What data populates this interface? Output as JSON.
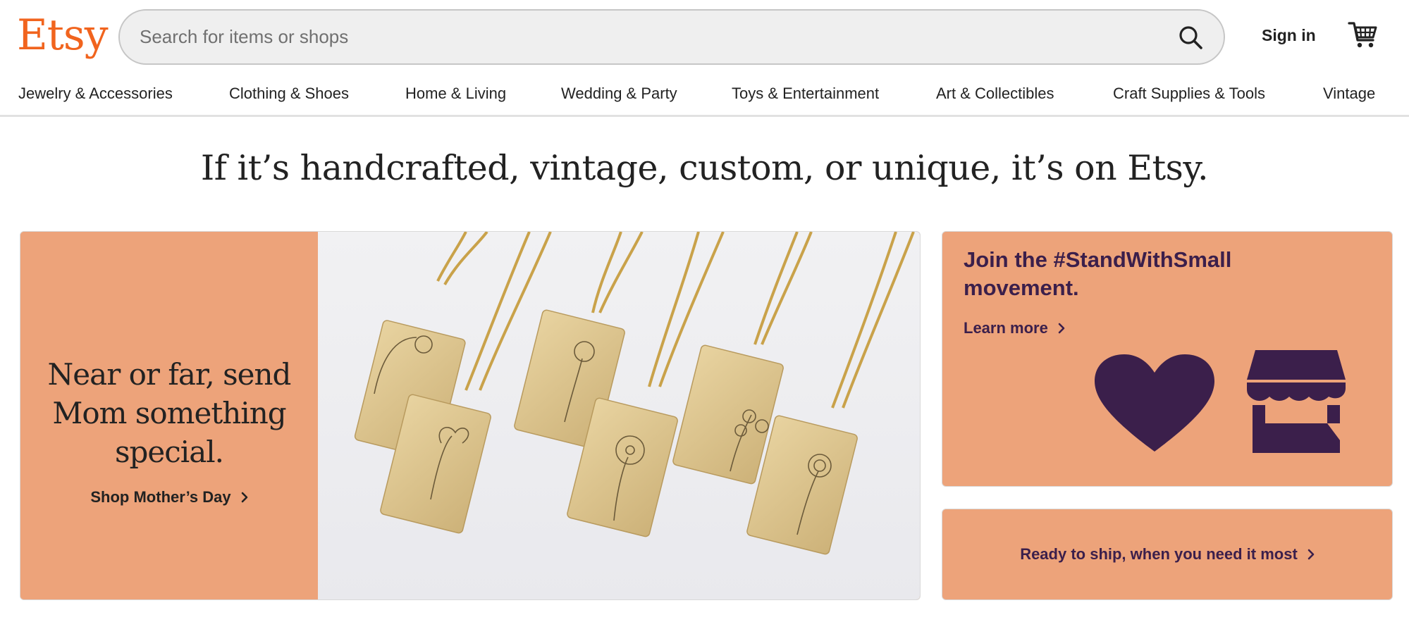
{
  "header": {
    "logo": "Etsy",
    "search": {
      "placeholder": "Search for items or shops",
      "icon": "search-icon"
    },
    "signin": "Sign in",
    "cart_icon": "cart-icon"
  },
  "nav": {
    "items": [
      {
        "label": "Jewelry & Accessories"
      },
      {
        "label": "Clothing & Shoes"
      },
      {
        "label": "Home & Living"
      },
      {
        "label": "Wedding & Party"
      },
      {
        "label": "Toys & Entertainment"
      },
      {
        "label": "Art & Collectibles"
      },
      {
        "label": "Craft Supplies & Tools"
      },
      {
        "label": "Vintage"
      }
    ]
  },
  "hero": {
    "title": "If it’s handcrafted, vintage, custom, or unique, it’s on Etsy."
  },
  "promo": {
    "headline": "Near or far, send Mom something special.",
    "link": "Shop Mother’s Day",
    "image_icon": "flower-pendant-necklaces-image"
  },
  "stand_with_small": {
    "headline": "Join the #StandWithSmall movement.",
    "link": "Learn more",
    "icons": [
      "heart-icon",
      "storefront-icon"
    ]
  },
  "ready": {
    "link": "Ready to ship, when you need it most"
  },
  "colors": {
    "brand": "#F1641E",
    "promo_bg": "#EDA37A",
    "purple": "#3b1f4b"
  }
}
